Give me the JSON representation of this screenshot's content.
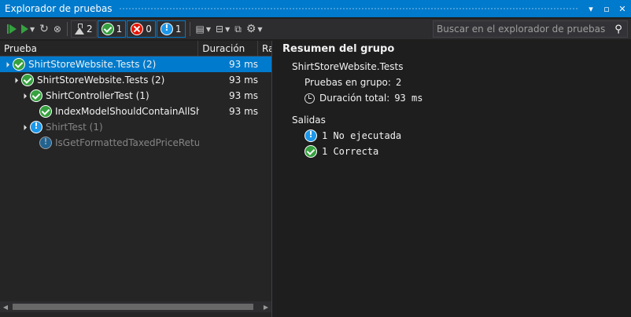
{
  "window": {
    "title": "Explorador de pruebas"
  },
  "toolbar": {
    "filters": {
      "total": "2",
      "passed": "1",
      "failed": "0",
      "not_run": "1"
    }
  },
  "search": {
    "placeholder": "Buscar en el explorador de pruebas"
  },
  "columns": {
    "test": "Prueba",
    "duration": "Duración",
    "rank": "Ra"
  },
  "tree": [
    {
      "name": "ShirtStoreWebsite.Tests (2)",
      "duration": "93 ms"
    },
    {
      "name": "ShirtStoreWebsite.Tests (2)",
      "duration": "93 ms"
    },
    {
      "name": "ShirtControllerTest (1)",
      "duration": "93 ms"
    },
    {
      "name": "IndexModelShouldContainAllSh...",
      "duration": "93 ms"
    },
    {
      "name": "ShirtTest (1)",
      "duration": ""
    },
    {
      "name": "IsGetFormattedTaxedPriceRetur...",
      "duration": ""
    }
  ],
  "summary": {
    "title": "Resumen del grupo",
    "group_name": "ShirtStoreWebsite.Tests",
    "tests_in_group_label": "Pruebas en grupo:",
    "tests_in_group_value": "2",
    "duration_label": "Duración total:",
    "duration_value": "93 ms",
    "outputs_label": "Salidas",
    "not_run": "1 No ejecutada",
    "passed": "1 Correcta"
  },
  "colors": {
    "accent": "#007acc",
    "pass": "#35a13f",
    "fail": "#e51400",
    "info": "#1c97ea"
  }
}
